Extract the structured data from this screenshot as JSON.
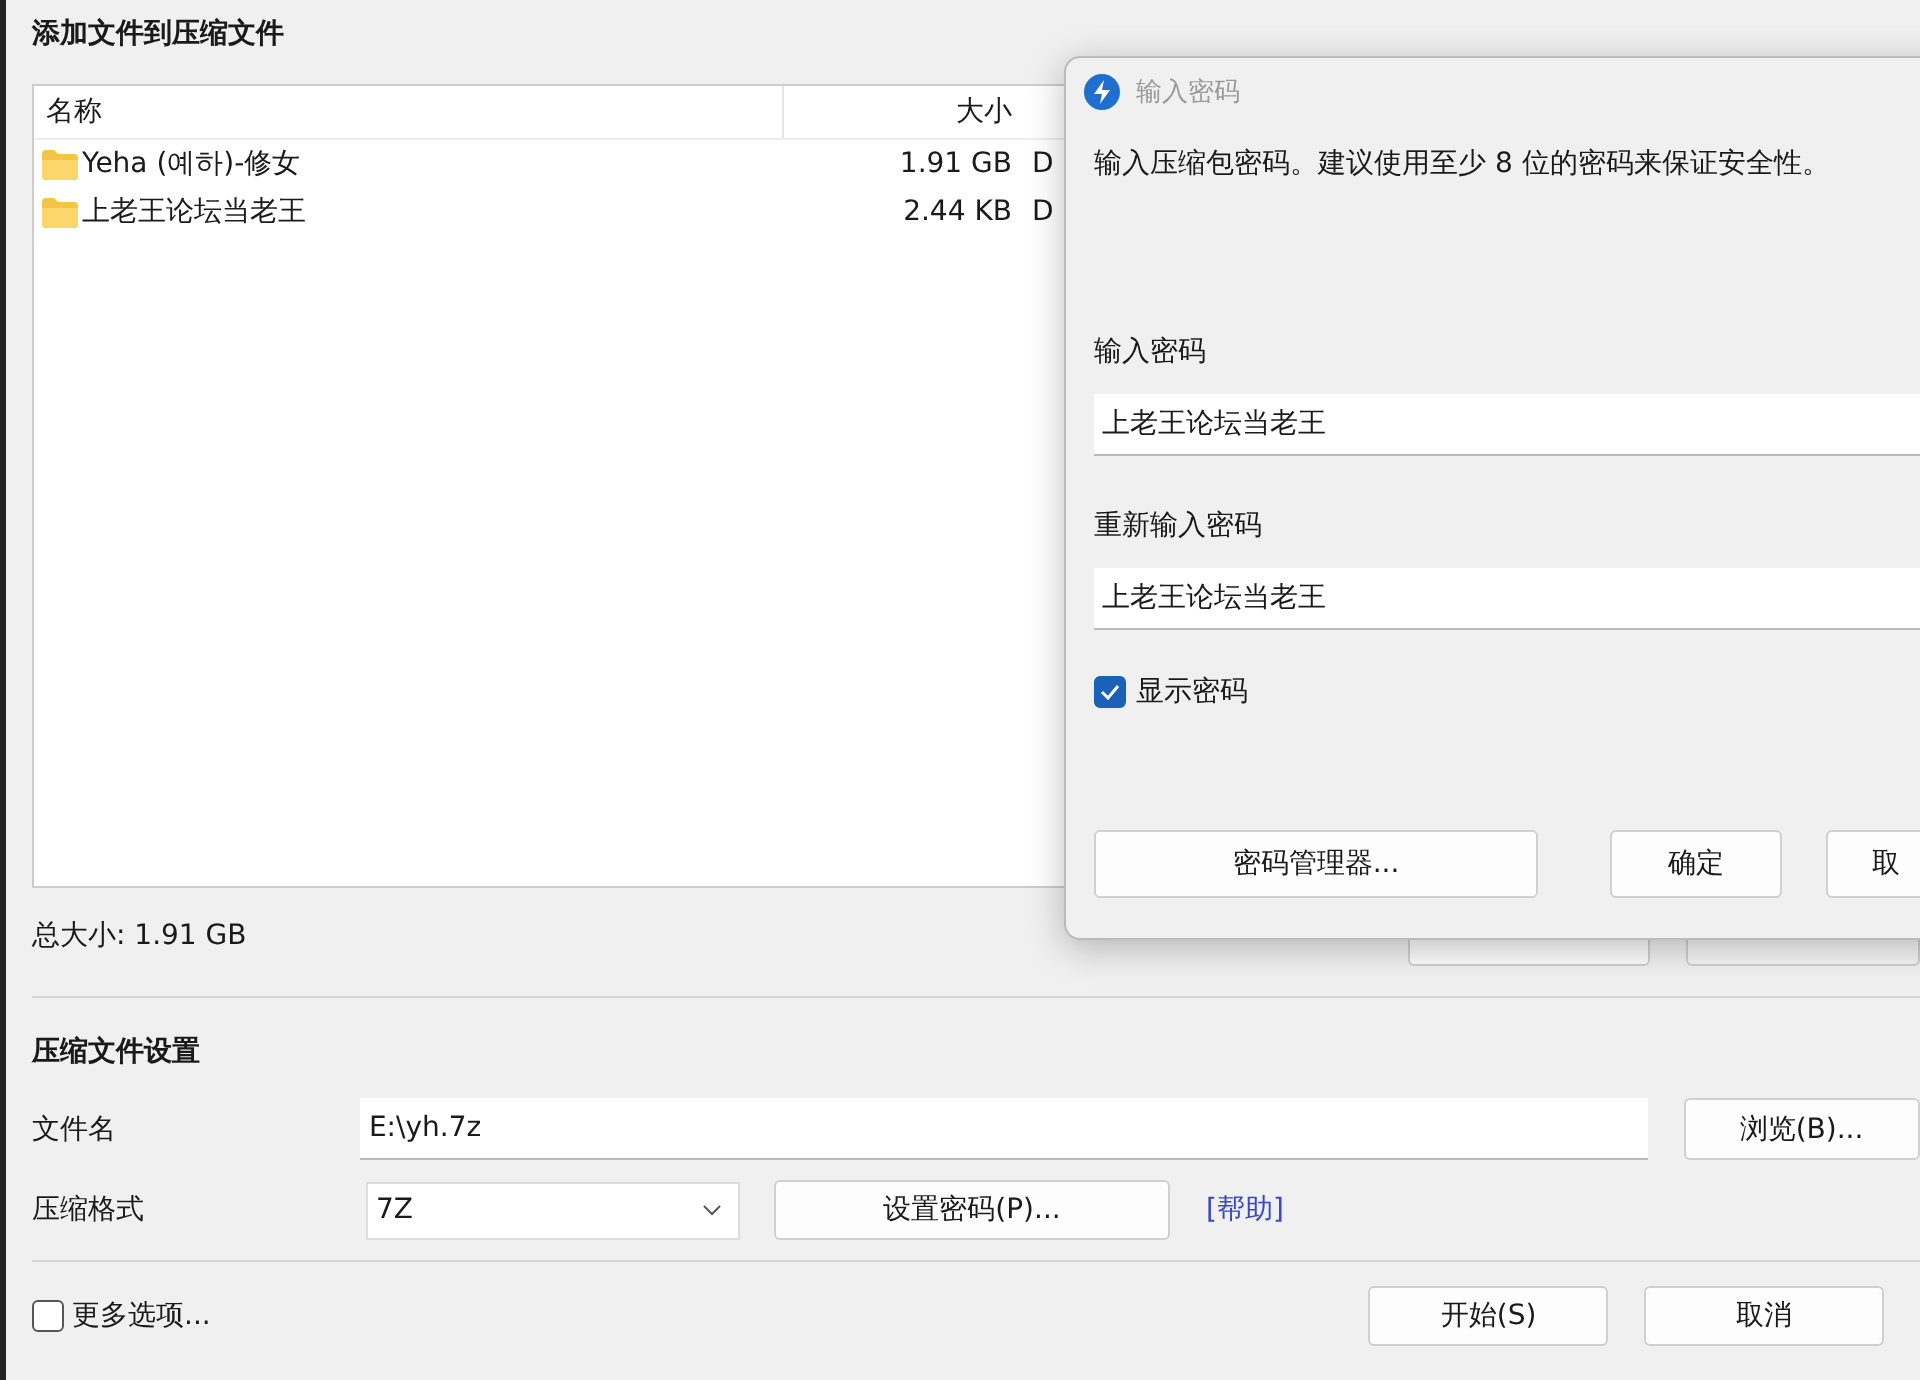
{
  "window": {
    "title": "添加文件到压缩文件"
  },
  "file_table": {
    "columns": [
      "名称",
      "大小"
    ],
    "rows": [
      {
        "name": "Yeha (예하)-修女",
        "size": "1.91 GB",
        "column_3": "D"
      },
      {
        "name": "上老王论坛当老王",
        "size": "2.44 KB",
        "column_3": "D"
      }
    ]
  },
  "total_size": "总大小: 1.91 GB",
  "settings": {
    "title": "压缩文件设置",
    "filename_label": "文件名",
    "filename": "E:\\yh.7z",
    "browse": "浏览(B)...",
    "format_label": "压缩格式",
    "format": "7Z",
    "set_password": "设置密码(P)...",
    "help": "[帮助]"
  },
  "more_options": {
    "label": "更多选项...",
    "checked": false
  },
  "buttons": [
    "开始(S)",
    "取消"
  ],
  "password_dialog": {
    "title": "输入密码",
    "message": "输入压缩包密码。建议使用至少 8 位的密码来保证安全性。",
    "password_label": "输入密码",
    "password": "上老王论坛当老王",
    "confirm_label": "重新输入密码",
    "confirm": "上老王论坛当老王",
    "show_password": {
      "label": "显示密码",
      "checked": true
    },
    "buttons": [
      "密码管理器...",
      "确定",
      "取"
    ]
  }
}
